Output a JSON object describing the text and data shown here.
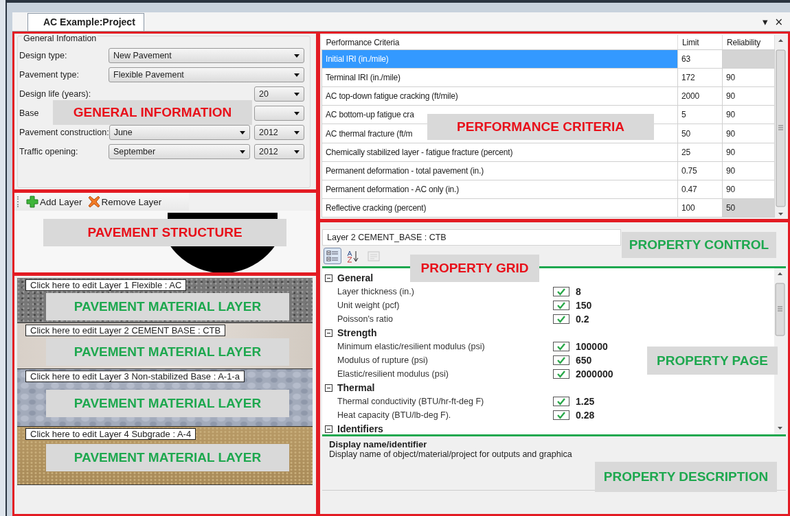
{
  "tab": {
    "title": "AC Example:Project"
  },
  "window_controls": [
    "▾",
    "×"
  ],
  "general_information": {
    "legend": "General Infomation",
    "fields": [
      {
        "label": "Design type:",
        "dropdowns": [
          {
            "kind": "wide",
            "value": "New Pavement"
          }
        ]
      },
      {
        "label": "Pavement type:",
        "dropdowns": [
          {
            "kind": "wide",
            "value": "Flexible Pavement"
          }
        ]
      },
      {
        "label": "Design life (years):",
        "dropdowns": [
          {
            "kind": "small",
            "value": "20"
          }
        ]
      },
      {
        "label": "Base",
        "dropdowns": [
          {
            "kind": "small"
          }
        ]
      },
      {
        "label": "Pavement construction:",
        "dropdowns": [
          {
            "kind": "medium",
            "value": "June"
          },
          {
            "kind": "small",
            "value": "2012"
          }
        ]
      },
      {
        "label": "Traffic opening:",
        "dropdowns": [
          {
            "kind": "medium",
            "value": "September"
          },
          {
            "kind": "small",
            "value": "2012"
          }
        ]
      }
    ],
    "callout": {
      "text": "GENERAL INFORMATION",
      "color": "#e8101a"
    }
  },
  "pavement_structure": {
    "toolbar": [
      {
        "kind": "add",
        "label": "Add Layer"
      },
      {
        "kind": "remove",
        "label": "Remove Layer"
      }
    ],
    "callout": {
      "text": "PAVEMENT STRUCTURE",
      "color": "#e8101a"
    }
  },
  "layers": [
    {
      "kind": "asphalt",
      "label": "Click here to edit Layer 1 Flexible : AC",
      "callout": {
        "text": "PAVEMENT MATERIAL LAYER",
        "color": "#1ea84f"
      }
    },
    {
      "kind": "cement",
      "label": "Click here to edit Layer 2 CEMENT  BASE : CTB",
      "callout": {
        "text": "PAVEMENT MATERIAL LAYER",
        "color": "#1ea84f"
      }
    },
    {
      "kind": "gravel",
      "label": "Click here to edit Layer 3 Non-stabilized Base : A-1-a",
      "callout": {
        "text": "PAVEMENT MATERIAL LAYER",
        "color": "#1ea84f"
      }
    },
    {
      "kind": "soil",
      "label": "Click here to edit Layer 4 Subgrade : A-4",
      "callout": {
        "text": "PAVEMENT MATERIAL LAYER",
        "color": "#1ea84f"
      }
    }
  ],
  "performance_criteria": {
    "columns": [
      "Performance Criteria",
      "Limit",
      "Reliability"
    ],
    "rows": [
      {
        "criterion": "Initial IRI  (in./mile)",
        "limit": "63",
        "locked": true,
        "selected": true
      },
      {
        "criterion": "Terminal IRI (in./mile)",
        "limit": "172",
        "reliability": "90",
        "locked": false,
        "selected": false
      },
      {
        "criterion": "AC top-down fatigue cracking (ft/mile)",
        "limit": "2000",
        "reliability": "90",
        "locked": false,
        "selected": false
      },
      {
        "criterion": "AC bottom-up fatigue cra",
        "limit": "5",
        "reliability": "90",
        "locked": false,
        "selected": false
      },
      {
        "criterion": "AC thermal fracture (ft/m",
        "limit": "50",
        "reliability": "90",
        "locked": false,
        "selected": false
      },
      {
        "criterion": "Chemically stabilized layer - fatigue fracture (percent)",
        "limit": "25",
        "reliability": "90",
        "locked": false,
        "selected": false
      },
      {
        "criterion": "Permanent deformation - total pavement (in.)",
        "limit": "0.75",
        "reliability": "90",
        "locked": false,
        "selected": false
      },
      {
        "criterion": "Permanent deformation - AC only (in.)",
        "limit": "0.47",
        "reliability": "90",
        "locked": false,
        "selected": false
      },
      {
        "criterion": "Reflective cracking (percent)",
        "limit": "100",
        "reliability": "50",
        "locked": true,
        "selected": false
      }
    ],
    "callout": {
      "text": "PERFORMANCE  CRITERIA",
      "color": "#e8101a"
    }
  },
  "property_control": {
    "selection": "Layer 2 CEMENT_BASE : CTB",
    "toolbar": [
      {
        "kind": "categorized",
        "selected": true,
        "disabled": false
      },
      {
        "kind": "alphabetical",
        "selected": false,
        "disabled": false
      },
      {
        "kind": "pages",
        "selected": false,
        "disabled": true
      }
    ],
    "categories": [
      {
        "name": "General",
        "expanded": true,
        "properties": [
          {
            "name": "Layer thickness (in.)",
            "checked": true,
            "value": "8"
          },
          {
            "name": "Unit weight (pcf)",
            "checked": true,
            "value": "150"
          },
          {
            "name": "Poisson's ratio",
            "checked": true,
            "value": "0.2"
          }
        ]
      },
      {
        "name": "Strength",
        "expanded": true,
        "properties": [
          {
            "name": "Minimum elastic/resilient modulus (psi)",
            "checked": true,
            "value": "100000"
          },
          {
            "name": "Modulus of rupture (psi)",
            "checked": true,
            "value": "650"
          },
          {
            "name": "Elastic/resilient modulus (psi)",
            "checked": true,
            "value": "2000000"
          }
        ]
      },
      {
        "name": "Thermal",
        "expanded": true,
        "properties": [
          {
            "name": "Thermal conductivity (BTU/hr-ft-deg F)",
            "checked": true,
            "value": "1.25"
          },
          {
            "name": "Heat capacity (BTU/lb-deg F).",
            "checked": true,
            "value": "0.28"
          }
        ]
      },
      {
        "name": "Identifiers",
        "expanded": true
      }
    ],
    "description": {
      "title": "Display name/identifier",
      "text": "Display name of object/material/project for outputs and graphica"
    },
    "callouts": [
      {
        "text": "PROPERTY CONTROL",
        "color": "#1ea84f"
      },
      {
        "text": "PROPERTY GRID",
        "color": "#e8101a"
      },
      {
        "text": "PROPERTY PAGE",
        "color": "#1ea84f"
      },
      {
        "text": "PROPERTY DESCRIPTION",
        "color": "#1ea84f"
      }
    ]
  }
}
